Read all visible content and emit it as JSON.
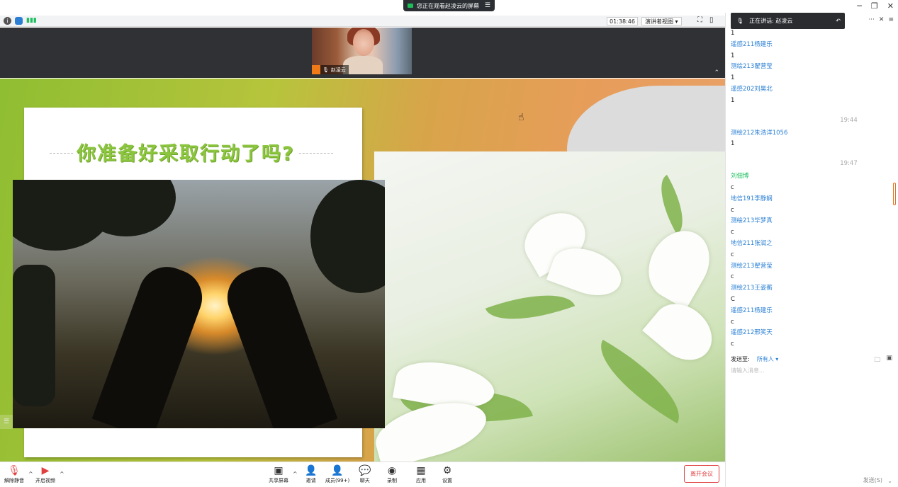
{
  "banner": {
    "text": "您正在观看赵凌云的屏幕"
  },
  "topbar": {
    "timer": "01:38:46",
    "view_label": "演讲者视图"
  },
  "speaker": {
    "name": "赵凌云"
  },
  "slide": {
    "title": "你准备好采取行动了吗?"
  },
  "chat": {
    "speaking_label": "正在讲话: 赵凌云",
    "messages": [
      {
        "type": "text",
        "text": "1"
      },
      {
        "type": "name",
        "text": "遥感211杨建乐"
      },
      {
        "type": "text",
        "text": "1"
      },
      {
        "type": "name",
        "text": "测绘213翟营莹"
      },
      {
        "type": "text",
        "text": "1"
      },
      {
        "type": "name",
        "text": "遥感202刘昊北"
      },
      {
        "type": "text",
        "text": "1"
      },
      {
        "type": "time",
        "text": "19:44"
      },
      {
        "type": "name",
        "text": "测绘212朱浩洋1056"
      },
      {
        "type": "text",
        "text": "1"
      },
      {
        "type": "time",
        "text": "19:47"
      },
      {
        "type": "name-green",
        "text": "刘佃博"
      },
      {
        "type": "text",
        "text": "c"
      },
      {
        "type": "name",
        "text": "地信191李静娴"
      },
      {
        "type": "text",
        "text": "c"
      },
      {
        "type": "name",
        "text": "测绘213毕梦真"
      },
      {
        "type": "text",
        "text": "c"
      },
      {
        "type": "name",
        "text": "地信211张润之"
      },
      {
        "type": "text",
        "text": "c"
      },
      {
        "type": "name",
        "text": "测绘213翟营莹"
      },
      {
        "type": "text",
        "text": "c"
      },
      {
        "type": "name",
        "text": "测绘213王姿蘅"
      },
      {
        "type": "text",
        "text": "C"
      },
      {
        "type": "name",
        "text": "遥感211杨建乐"
      },
      {
        "type": "text",
        "text": "c"
      },
      {
        "type": "name",
        "text": "遥感212邢笑天"
      },
      {
        "type": "text",
        "text": "c"
      }
    ],
    "send_to_label": "发送至:",
    "send_to_value": "所有人 ▾",
    "input_placeholder": "请输入消息...",
    "send_button": "发送(S)"
  },
  "toolbar": {
    "mute": "解除静音",
    "video": "开启视频",
    "share": "共享屏幕",
    "invite": "邀请",
    "members": "成员(99+)",
    "chat": "聊天",
    "record": "录制",
    "apps": "应用",
    "settings": "设置",
    "leave": "离开会议"
  },
  "colors": {
    "accent_blue": "#2a7fd4",
    "leave_red": "#e04040",
    "green_name": "#1fbf5f"
  }
}
